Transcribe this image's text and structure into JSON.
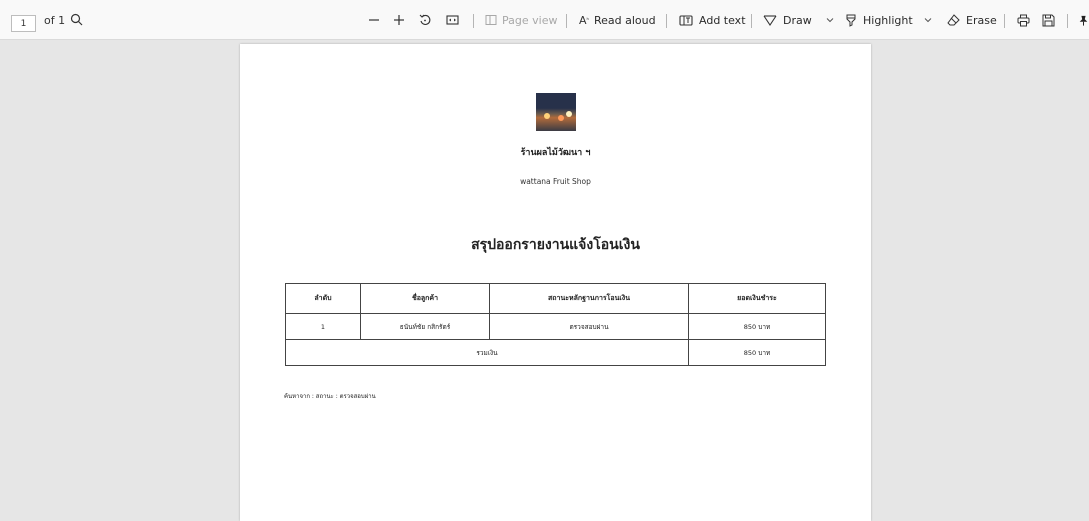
{
  "toolbar": {
    "page_number": "1",
    "page_of": "of 1",
    "page_view": "Page view",
    "read_aloud": "Read aloud",
    "add_text": "Add text",
    "draw": "Draw",
    "highlight": "Highlight",
    "erase": "Erase"
  },
  "document": {
    "shop_name_th": "ร้านผลไม้วัฒนา ฯ",
    "shop_name_en": "wattana Fruit Shop",
    "report_title": "สรุปออกรายงานแจ้งโอนเงิน",
    "table": {
      "headers": [
        "ลำดับ",
        "ชื่อลูกค้า",
        "สถานะหลักฐานการโอนเงิน",
        "ยอดเงินชำระ"
      ],
      "rows": [
        [
          "1",
          "ธนันท์ชัย กสิกรัตร์",
          "ตรวจสอบผ่าน",
          "850 บาท"
        ]
      ],
      "total_label": "รวมเงิน",
      "total_value": "850 บาท"
    },
    "search_note": "ค้นหาจาก : สถานะ : ตรวจสอบผ่าน"
  }
}
